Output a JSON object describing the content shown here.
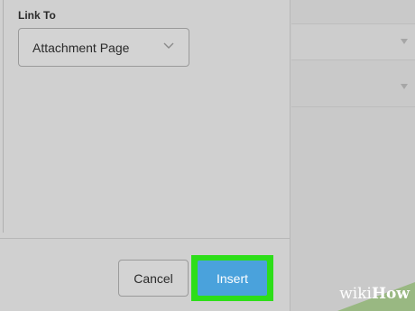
{
  "link_to": {
    "label": "Link To",
    "selected_value": "Attachment Page",
    "chevron_icon": "chevron-down-icon"
  },
  "buttons": {
    "cancel_label": "Cancel",
    "insert_label": "Insert"
  },
  "watermark": {
    "text_wiki": "wiki",
    "text_how": "How"
  },
  "colors": {
    "insert_button": "#4aa2dc",
    "highlight_box": "#2dde19",
    "panel_background": "#d0d0d0"
  }
}
